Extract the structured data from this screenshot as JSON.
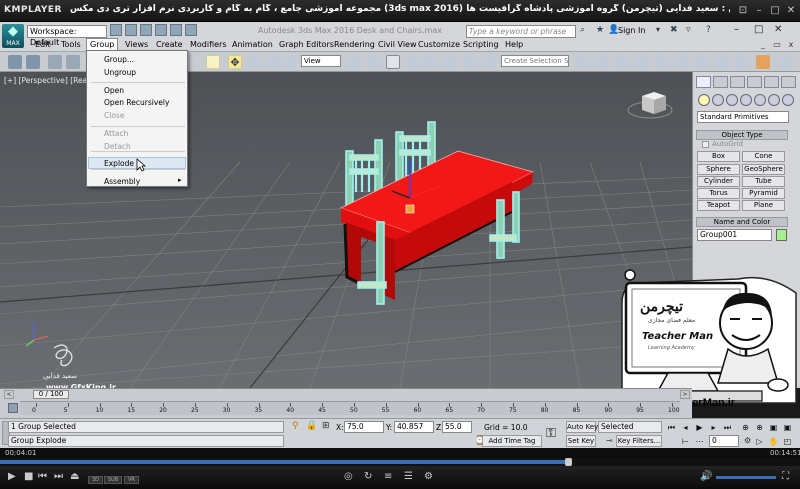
{
  "player": {
    "name": "KMPLAYER",
    "title": "مجموعه آموزشی جامع ، گام به گام و کاربردی نرم افزار تری دی مکس (3ds max 2016) مدرس : سعید فدایی (تیچرمن) گروه آموزشی پادشاه گرافیست ها",
    "time_current": "00:04:01",
    "time_total": "00:14:51",
    "progress": 0.71
  },
  "max": {
    "logo_text": "MAX",
    "workspace": "Workspace: Default",
    "doc_title": "Autodesk 3ds Max 2016    Desk and Chairs.max",
    "search_placeholder": "Type a keyword or phrase",
    "sign_in": "Sign In"
  },
  "menu": {
    "items": [
      "Edit",
      "Tools",
      "Group",
      "Views",
      "Create",
      "Modifiers",
      "Animation",
      "Graph Editors",
      "Rendering",
      "Civil View",
      "Customize",
      "Scripting",
      "Help"
    ],
    "active": "Group"
  },
  "toolbar": {
    "view_dropdown": "View",
    "selection_set_placeholder": "Create Selection Se"
  },
  "viewport": {
    "label": "[+] [Perspective] [Realistic]"
  },
  "group_menu": {
    "items": [
      {
        "label": "Group...",
        "enabled": true
      },
      {
        "label": "Ungroup",
        "enabled": true
      },
      {
        "label": "Open",
        "enabled": true
      },
      {
        "label": "Open Recursively",
        "enabled": true
      },
      {
        "label": "Close",
        "enabled": false
      },
      {
        "label": "Attach",
        "enabled": false
      },
      {
        "label": "Detach",
        "enabled": false
      },
      {
        "label": "Explode",
        "enabled": true
      },
      {
        "label": "Assembly",
        "enabled": true
      }
    ],
    "highlighted": "Explode"
  },
  "command_panel": {
    "category": "Standard Primitives",
    "object_type_header": "Object Type",
    "autogrid": "AutoGrid",
    "primitives": [
      "Box",
      "Cone",
      "Sphere",
      "GeoSphere",
      "Cylinder",
      "Tube",
      "Torus",
      "Pyramid",
      "Teapot",
      "Plane"
    ],
    "name_color_header": "Name and Color",
    "object_name": "Group001",
    "object_color": "#a5f08f"
  },
  "watermark": {
    "name": "سعید فدایی",
    "site": "www.GfxKing.ir"
  },
  "teacher": {
    "title_fa": "تیچرمن",
    "subtitle_fa": "معلم فضای مجازی",
    "name_en": "Teacher Man",
    "tagline": "Learning Academy",
    "url": "www.TeacherMan.ir"
  },
  "timeline": {
    "slider": "0 / 100",
    "ticks": [
      0,
      5,
      10,
      15,
      20,
      25,
      30,
      35,
      40,
      45,
      50,
      55,
      60,
      65,
      70,
      75,
      80,
      85,
      90,
      95,
      100
    ]
  },
  "status": {
    "selected": "1 Group Selected",
    "prompt": "Group Explode",
    "x_label": "X:",
    "x": "75.0",
    "y_label": "Y:",
    "y": "40.857",
    "z_label": "Z:",
    "z": "55.0",
    "grid": "Grid = 10.0",
    "add_time_tag": "Add Time Tag",
    "auto_key": "Auto Key",
    "set_key": "Set Key",
    "key_mode": "Selected",
    "key_filters": "Key Filters...",
    "frame": "0"
  }
}
